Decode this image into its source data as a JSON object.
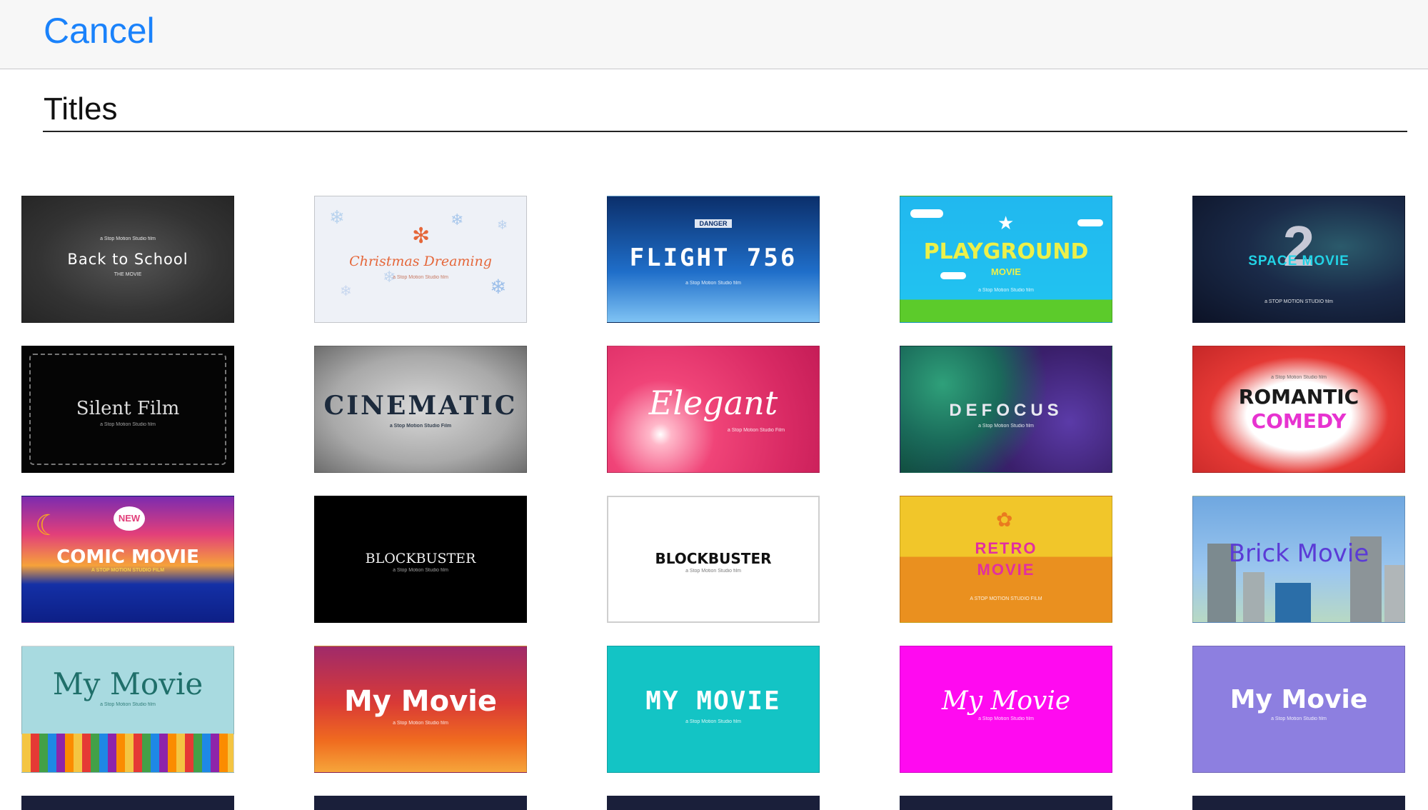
{
  "header": {
    "cancel_label": "Cancel"
  },
  "section": {
    "title": "Titles"
  },
  "tiles": [
    {
      "name": "tile-back-to-school",
      "title": "Back to School",
      "top": "a Stop Motion Studio film",
      "sub": "THE MOVIE"
    },
    {
      "name": "tile-christmas-dreaming",
      "title": "Christmas Dreaming",
      "sub": "a Stop Motion Studio film"
    },
    {
      "name": "tile-flight-756",
      "top": "DANGER",
      "title": "FLIGHT 756",
      "sub": "a Stop Motion Studio film"
    },
    {
      "name": "tile-playground-movie",
      "title": "PLAYGROUND",
      "title2": "MOVIE",
      "sub": "a Stop Motion Studio film"
    },
    {
      "name": "tile-space-movie",
      "big": "2",
      "title": "SPACE MOVIE",
      "sub": "a STOP MOTION STUDIO film"
    },
    {
      "name": "tile-silent-film",
      "title": "Silent Film",
      "sub": "a Stop Motion Studio film"
    },
    {
      "name": "tile-cinematic",
      "title": "CINEMATIC",
      "sub": "a Stop Motion Studio Film"
    },
    {
      "name": "tile-elegant",
      "title": "Elegant",
      "sub": "a Stop Motion Studio Film"
    },
    {
      "name": "tile-defocus",
      "title": "DEFOCUS",
      "sub": "a Stop Motion Studio film"
    },
    {
      "name": "tile-romantic-comedy",
      "top": "a Stop Motion Studio film",
      "title": "ROMANTIC",
      "title2": "COMEDY"
    },
    {
      "name": "tile-comic-movie",
      "badge": "NEW",
      "title": "COMIC MOVIE",
      "sub": "A STOP MOTION STUDIO FILM"
    },
    {
      "name": "tile-blockbuster-dark",
      "title": "BLOCKBUSTER",
      "sub": "a Stop Motion Studio film"
    },
    {
      "name": "tile-blockbuster-light",
      "title": "BLOCKBUSTER",
      "sub": "a Stop Motion Studio film"
    },
    {
      "name": "tile-retro-movie",
      "title": "RETRO",
      "title2": "MOVIE",
      "sub": "A STOP MOTION STUDIO FILM"
    },
    {
      "name": "tile-brick-movie",
      "title": "Brick Movie"
    },
    {
      "name": "tile-my-movie-pencils",
      "title": "My Movie",
      "sub": "a Stop Motion Studio film"
    },
    {
      "name": "tile-my-movie-sunset",
      "title": "My Movie",
      "sub": "a Stop Motion Studio film"
    },
    {
      "name": "tile-my-movie-teal",
      "title": "MY MOVIE",
      "sub": "a Stop Motion Studio film"
    },
    {
      "name": "tile-my-movie-magenta",
      "title": "My Movie",
      "sub": "a Stop Motion Studio film"
    },
    {
      "name": "tile-my-movie-purple",
      "title": "My Movie",
      "sub": "a Stop Motion Studio film"
    }
  ],
  "colors": {
    "accent": "#1a82fb",
    "bar": "#f7f7f7"
  },
  "icons": {
    "snowflake": "snowflake-icon",
    "flower": "flower-icon",
    "star": "star-icon",
    "cloud": "cloud-icon"
  }
}
